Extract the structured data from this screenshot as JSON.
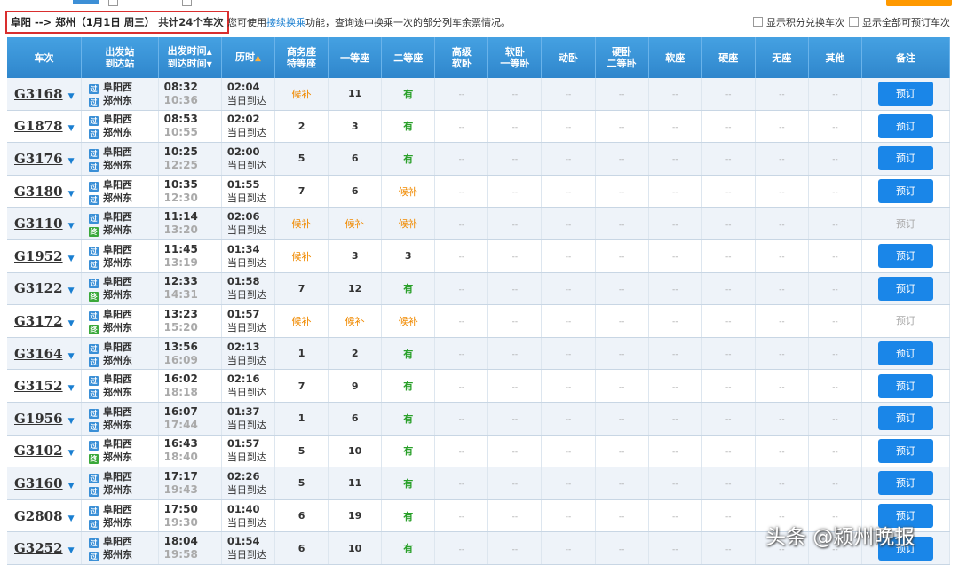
{
  "infobar": {
    "route": "阜阳 --> 郑州（1月1日 周三）",
    "count": "共计24个车次",
    "tip_prefix": "您可使用",
    "tip_link": "接续换乘",
    "tip_suffix": "功能，查询途中换乘一次的部分列车余票情况。",
    "opt_points": "显示积分兑换车次",
    "opt_all": "显示全部可预订车次"
  },
  "headers": {
    "train": "车次",
    "station_from": "出发站",
    "station_to": "到达站",
    "time_dep": "出发时间",
    "time_arr": "到达时间",
    "duration": "历时",
    "business_1": "商务座",
    "business_2": "特等座",
    "first": "一等座",
    "second": "二等座",
    "hisoft_1": "高级",
    "hisoft_2": "软卧",
    "softbed_1": "软卧",
    "softbed_2": "一等卧",
    "dongwo": "动卧",
    "hardbed_1": "硬卧",
    "hardbed_2": "二等卧",
    "softseat": "软座",
    "hardseat": "硬座",
    "noseat": "无座",
    "other": "其他",
    "remark": "备注"
  },
  "dash": "--",
  "book_label": "预订",
  "arrive_label": "当日到达",
  "badges": {
    "pass": "过",
    "end": "终"
  },
  "rows": [
    {
      "train": "G3168",
      "from": "阜阳西",
      "to": "郑州东",
      "to_badge": "pass",
      "dep": "08:32",
      "arr": "10:36",
      "dur": "02:04",
      "business": "候补",
      "first": "11",
      "second": "有",
      "bookable": true
    },
    {
      "train": "G1878",
      "from": "阜阳西",
      "to": "郑州东",
      "to_badge": "pass",
      "dep": "08:53",
      "arr": "10:55",
      "dur": "02:02",
      "business": "2",
      "first": "3",
      "second": "有",
      "bookable": true
    },
    {
      "train": "G3176",
      "from": "阜阳西",
      "to": "郑州东",
      "to_badge": "pass",
      "dep": "10:25",
      "arr": "12:25",
      "dur": "02:00",
      "business": "5",
      "first": "6",
      "second": "有",
      "bookable": true
    },
    {
      "train": "G3180",
      "from": "阜阳西",
      "to": "郑州东",
      "to_badge": "pass",
      "dep": "10:35",
      "arr": "12:30",
      "dur": "01:55",
      "business": "7",
      "first": "6",
      "second": "候补",
      "bookable": true
    },
    {
      "train": "G3110",
      "from": "阜阳西",
      "to": "郑州东",
      "to_badge": "end",
      "dep": "11:14",
      "arr": "13:20",
      "dur": "02:06",
      "business": "候补",
      "first": "候补",
      "second": "候补",
      "bookable": false
    },
    {
      "train": "G1952",
      "from": "阜阳西",
      "to": "郑州东",
      "to_badge": "pass",
      "dep": "11:45",
      "arr": "13:19",
      "dur": "01:34",
      "business": "候补",
      "first": "3",
      "second": "3",
      "bookable": true
    },
    {
      "train": "G3122",
      "from": "阜阳西",
      "to": "郑州东",
      "to_badge": "end",
      "dep": "12:33",
      "arr": "14:31",
      "dur": "01:58",
      "business": "7",
      "first": "12",
      "second": "有",
      "bookable": true
    },
    {
      "train": "G3172",
      "from": "阜阳西",
      "to": "郑州东",
      "to_badge": "end",
      "dep": "13:23",
      "arr": "15:20",
      "dur": "01:57",
      "business": "候补",
      "first": "候补",
      "second": "候补",
      "bookable": false
    },
    {
      "train": "G3164",
      "from": "阜阳西",
      "to": "郑州东",
      "to_badge": "pass",
      "dep": "13:56",
      "arr": "16:09",
      "dur": "02:13",
      "business": "1",
      "first": "2",
      "second": "有",
      "bookable": true
    },
    {
      "train": "G3152",
      "from": "阜阳西",
      "to": "郑州东",
      "to_badge": "pass",
      "dep": "16:02",
      "arr": "18:18",
      "dur": "02:16",
      "business": "7",
      "first": "9",
      "second": "有",
      "bookable": true
    },
    {
      "train": "G1956",
      "from": "阜阳西",
      "to": "郑州东",
      "to_badge": "pass",
      "dep": "16:07",
      "arr": "17:44",
      "dur": "01:37",
      "business": "1",
      "first": "6",
      "second": "有",
      "bookable": true
    },
    {
      "train": "G3102",
      "from": "阜阳西",
      "to": "郑州东",
      "to_badge": "end",
      "dep": "16:43",
      "arr": "18:40",
      "dur": "01:57",
      "business": "5",
      "first": "10",
      "second": "有",
      "bookable": true
    },
    {
      "train": "G3160",
      "from": "阜阳西",
      "to": "郑州东",
      "to_badge": "pass",
      "dep": "17:17",
      "arr": "19:43",
      "dur": "02:26",
      "business": "5",
      "first": "11",
      "second": "有",
      "bookable": true
    },
    {
      "train": "G2808",
      "from": "阜阳西",
      "to": "郑州东",
      "to_badge": "pass",
      "dep": "17:50",
      "arr": "19:30",
      "dur": "01:40",
      "business": "6",
      "first": "19",
      "second": "有",
      "bookable": true
    },
    {
      "train": "G3252",
      "from": "阜阳西",
      "to": "郑州东",
      "to_badge": "pass",
      "dep": "18:04",
      "arr": "19:58",
      "dur": "01:54",
      "business": "6",
      "first": "10",
      "second": "有",
      "bookable": true
    }
  ],
  "watermark": "头条 @颍州晚报",
  "colors": {
    "header_blue": "#3a93d6",
    "button_blue": "#1a86e8",
    "available_green": "#2aa02a",
    "waitlist_orange": "#f08a00",
    "route_border_red": "#d92e2e"
  }
}
